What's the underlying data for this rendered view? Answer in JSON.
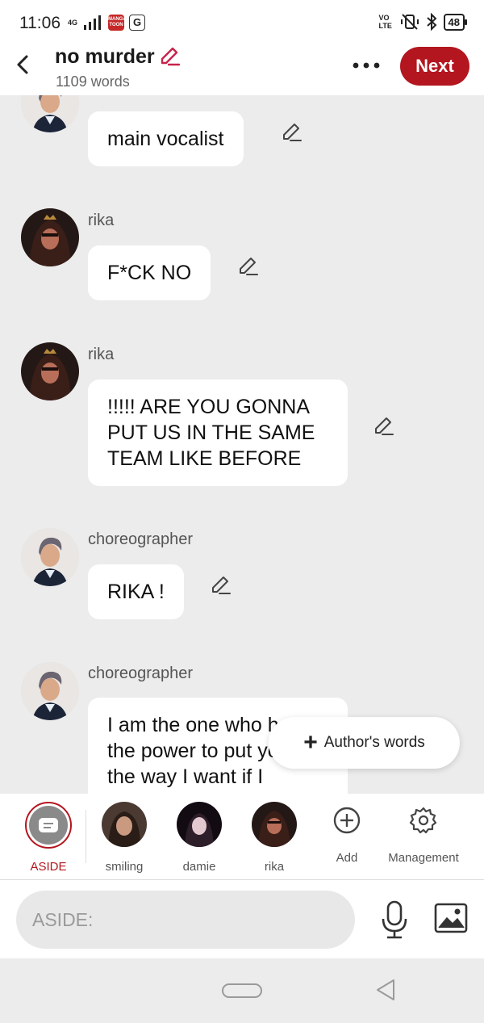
{
  "status_bar": {
    "time": "11:06",
    "network": "4G",
    "app_badge_text": "MANGA TOON",
    "g_badge": "G",
    "volte": "VO LTE",
    "battery": "48"
  },
  "header": {
    "title": "no murder",
    "subtitle": "1109 words",
    "next_label": "Next"
  },
  "messages": [
    {
      "name": "",
      "text": "main vocalist",
      "avatar": "choreographer"
    },
    {
      "name": "rika",
      "text": "F*CK NO",
      "avatar": "rika"
    },
    {
      "name": "rika",
      "text": "!!!!! ARE YOU GONNA PUT US IN THE SAME TEAM LIKE BEFORE",
      "avatar": "rika"
    },
    {
      "name": "choreographer",
      "text": "RIKA !",
      "avatar": "choreographer"
    },
    {
      "name": "choreographer",
      "text": "I am the one who has the power to put you all the way I want if I",
      "avatar": "choreographer"
    }
  ],
  "fab": {
    "label": "Author's words"
  },
  "character_bar": {
    "items": [
      {
        "label": "ASIDE",
        "selected": true
      },
      {
        "label": "smiling"
      },
      {
        "label": "damie"
      },
      {
        "label": "rika"
      }
    ],
    "add_label": "Add",
    "management_label": "Management"
  },
  "input": {
    "placeholder": "ASIDE:"
  },
  "colors": {
    "accent": "#b3161f",
    "background": "#ececec",
    "bubble": "#ffffff"
  }
}
